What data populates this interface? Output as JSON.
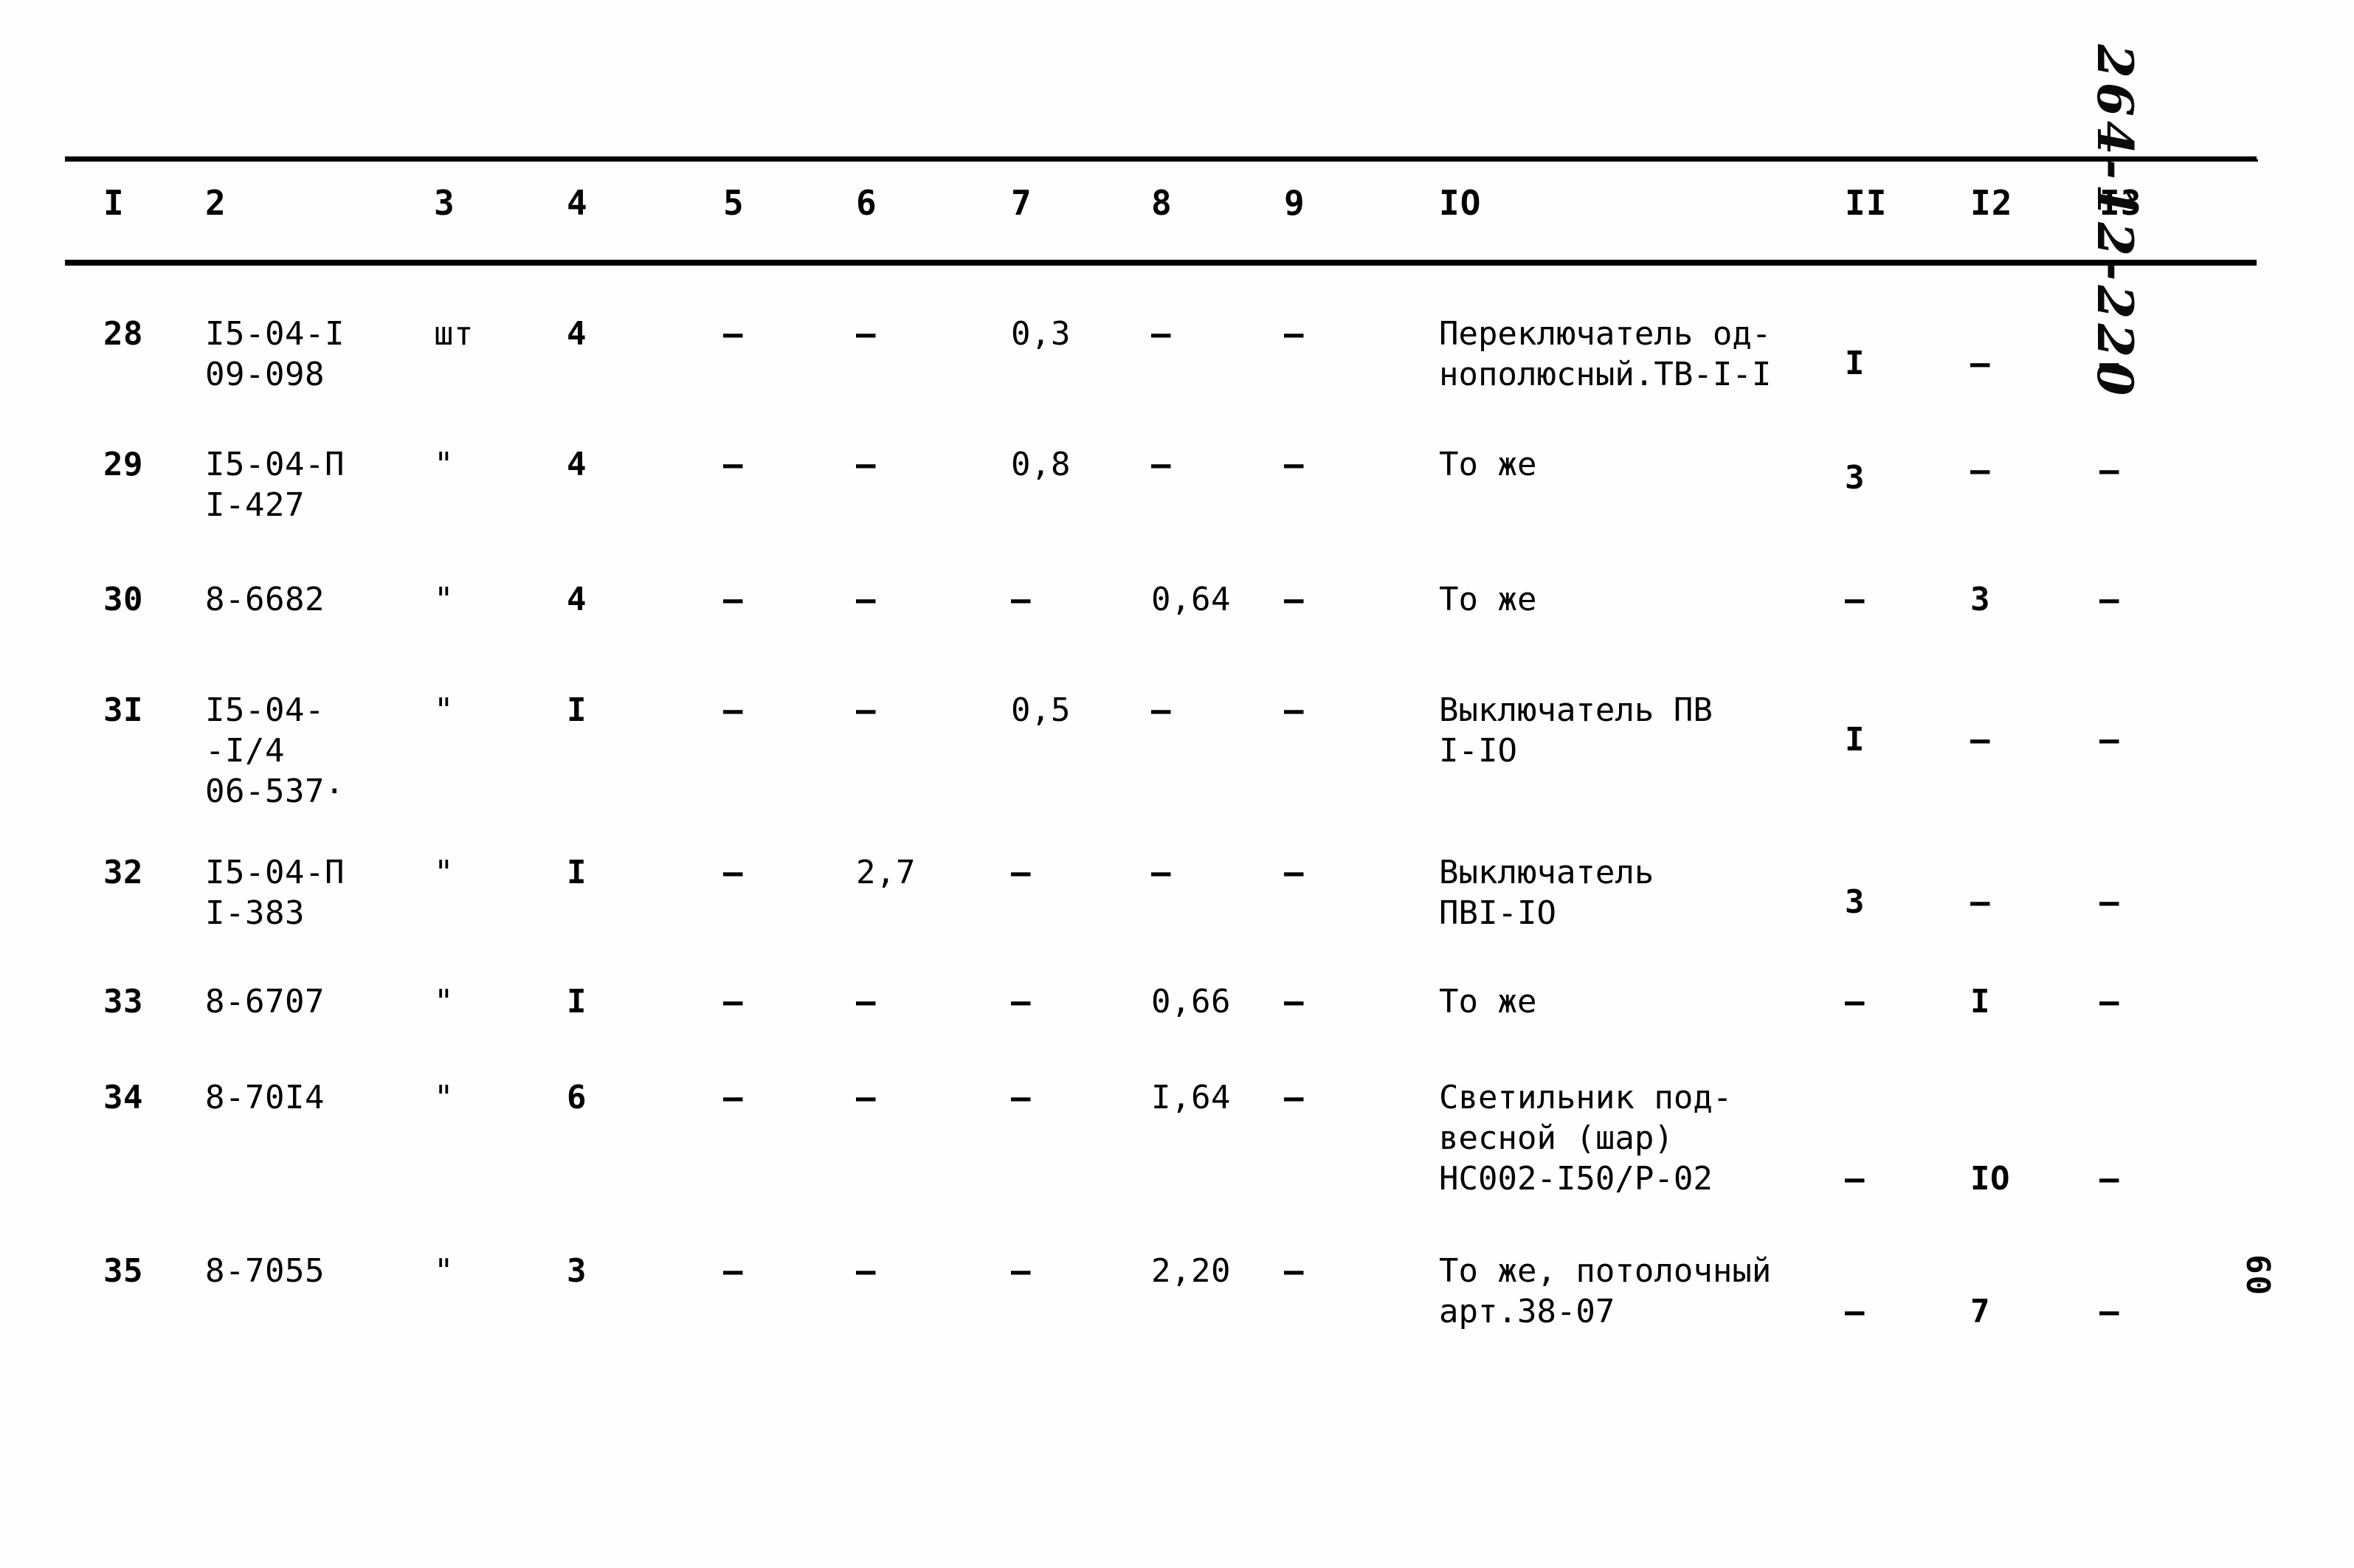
{
  "document": {
    "handwritten_annotation": "264-12-220",
    "page_number": "60"
  },
  "table": {
    "headers": [
      "I",
      "2",
      "3",
      "4",
      "5",
      "6",
      "7",
      "8",
      "9",
      "IO",
      "II",
      "I2",
      "I3"
    ],
    "rows": [
      {
        "c1": "28",
        "c2": "I5-04-I\n09-098",
        "c3": "шт",
        "c4": "4",
        "c5": "–",
        "c6": "–",
        "c7": "0,3",
        "c8": "–",
        "c9": "–",
        "c10": "Переключатель од-\nнополюсный.ТВ-I-I",
        "c11": "I",
        "c12": "–",
        "c13": "–"
      },
      {
        "c1": "29",
        "c2": "I5-04-П\nI-427",
        "c3": "\"",
        "c4": "4",
        "c5": "–",
        "c6": "–",
        "c7": "0,8",
        "c8": "–",
        "c9": "–",
        "c10": "То же",
        "c11": "3",
        "c12": "–",
        "c13": "–"
      },
      {
        "c1": "30",
        "c2": "8-6682",
        "c3": "\"",
        "c4": "4",
        "c5": "–",
        "c6": "–",
        "c7": "–",
        "c8": "0,64",
        "c9": "–",
        "c10": "То же",
        "c11": "–",
        "c12": "3",
        "c13": "–"
      },
      {
        "c1": "3I",
        "c2": "I5-04-\n-I/4\n06-537·",
        "c3": "\"",
        "c4": "I",
        "c5": "–",
        "c6": "–",
        "c7": "0,5",
        "c8": "–",
        "c9": "–",
        "c10": "Выключатель ПВ\nI-IO",
        "c11": "I",
        "c12": "–",
        "c13": "–"
      },
      {
        "c1": "32",
        "c2": "I5-04-П\nI-383",
        "c3": "\"",
        "c4": "I",
        "c5": "–",
        "c6": "2,7",
        "c7": "–",
        "c8": "–",
        "c9": "–",
        "c10": "Выключатель\nПВI-IO",
        "c11": "3",
        "c12": "–",
        "c13": "–"
      },
      {
        "c1": "33",
        "c2": "8-6707",
        "c3": "\"",
        "c4": "I",
        "c5": "–",
        "c6": "–",
        "c7": "–",
        "c8": "0,66",
        "c9": "–",
        "c10": "То же",
        "c11": "–",
        "c12": "I",
        "c13": "–"
      },
      {
        "c1": "34",
        "c2": "8-70I4",
        "c3": "\"",
        "c4": "6",
        "c5": "–",
        "c6": "–",
        "c7": "–",
        "c8": "I,64",
        "c9": "–",
        "c10": "Светильник под-\nвесной (шар)\nНС002-I50/Р-02",
        "c11": "–",
        "c12": "IO",
        "c13": "–"
      },
      {
        "c1": "35",
        "c2": "8-7055",
        "c3": "\"",
        "c4": "3",
        "c5": "–",
        "c6": "–",
        "c7": "–",
        "c8": "2,20",
        "c9": "–",
        "c10": "То же, потолочный\nарт.38-07",
        "c11": "–",
        "c12": "7",
        "c13": "–"
      }
    ]
  }
}
